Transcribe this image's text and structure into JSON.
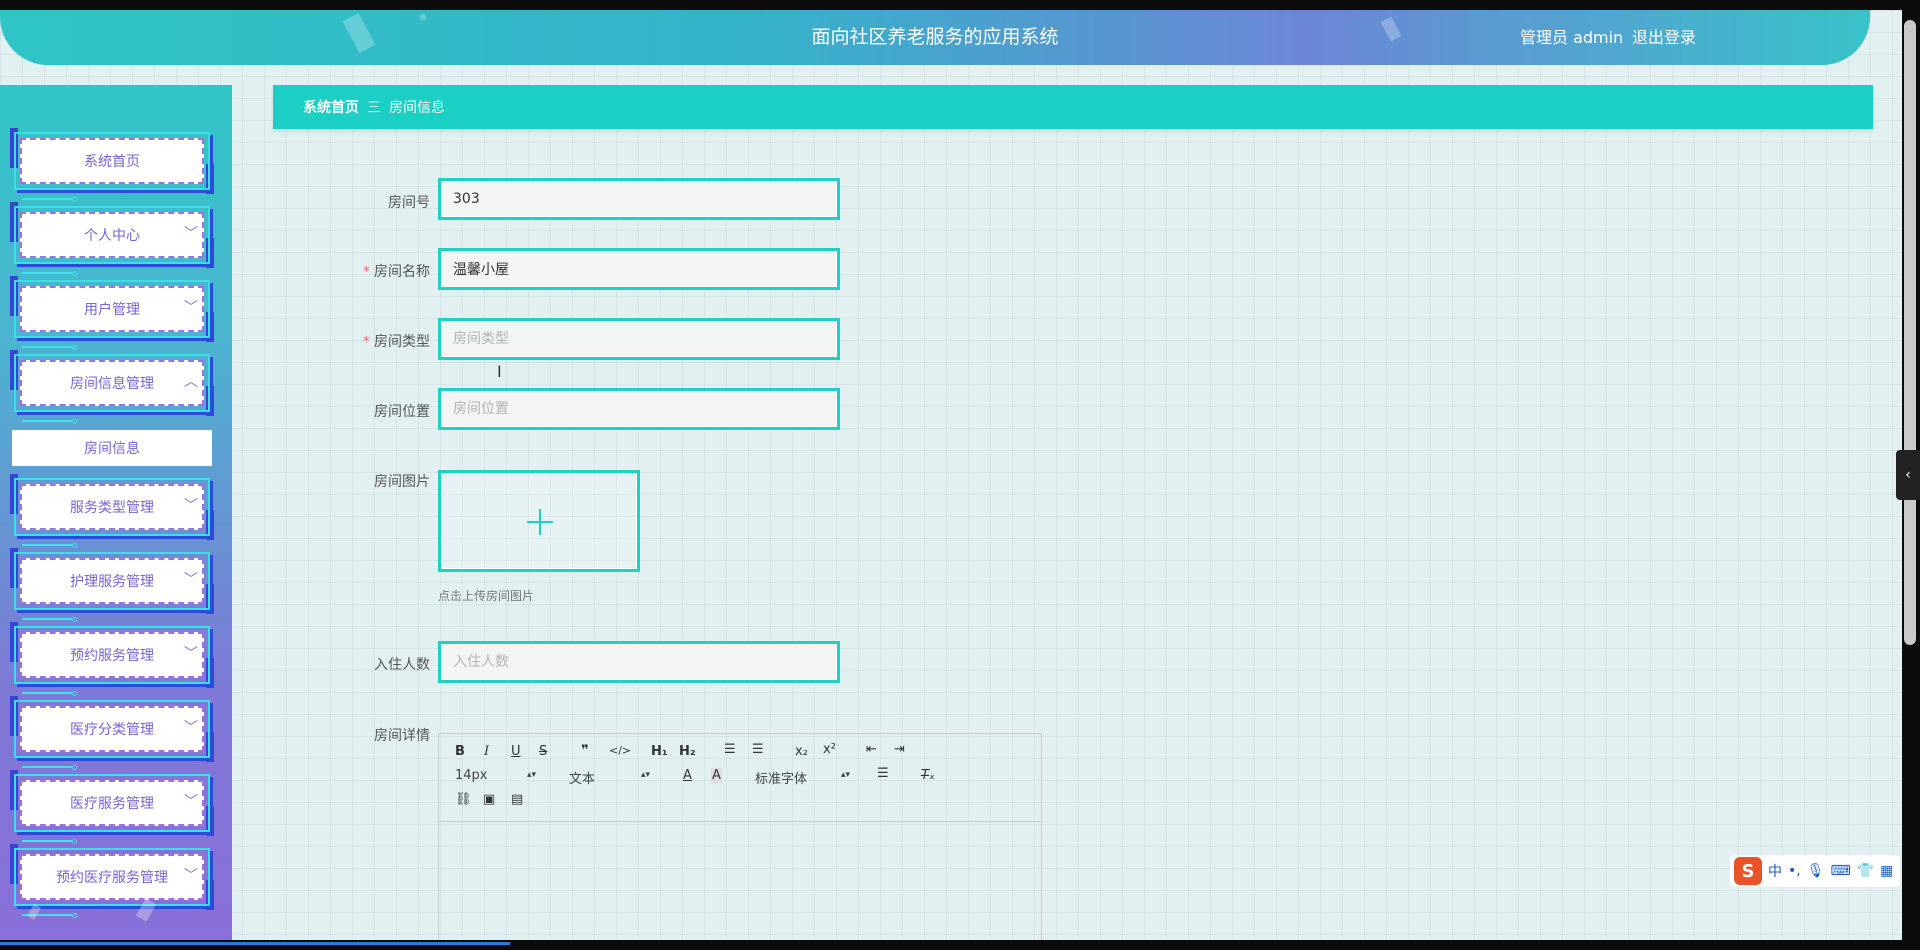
{
  "header": {
    "title": "面向社区养老服务的应用系统",
    "user": "管理员 admin",
    "logout": "退出登录"
  },
  "sidebar": {
    "items": [
      {
        "label": "系统首页",
        "chevron": ""
      },
      {
        "label": "个人中心",
        "chevron": "﹀"
      },
      {
        "label": "用户管理",
        "chevron": "﹀"
      },
      {
        "label": "房间信息管理",
        "chevron": "︿"
      },
      {
        "label": "服务类型管理",
        "chevron": "﹀"
      },
      {
        "label": "护理服务管理",
        "chevron": "﹀"
      },
      {
        "label": "预约服务管理",
        "chevron": "﹀"
      },
      {
        "label": "医疗分类管理",
        "chevron": "﹀"
      },
      {
        "label": "医疗服务管理",
        "chevron": "﹀"
      },
      {
        "label": "预约医疗服务管理",
        "chevron": "﹀"
      }
    ],
    "submenu": {
      "label": "房间信息"
    }
  },
  "breadcrumb": {
    "home": "系统首页",
    "separator": "三",
    "current": "房间信息"
  },
  "form": {
    "room_no": {
      "label": "房间号",
      "value": "303",
      "placeholder": "房间号"
    },
    "room_name": {
      "label": "房间名称",
      "value": "温馨小屋",
      "placeholder": "房间名称",
      "required": "*"
    },
    "room_type": {
      "label": "房间类型",
      "value": "",
      "placeholder": "房间类型",
      "required": "*"
    },
    "room_location": {
      "label": "房间位置",
      "value": "",
      "placeholder": "房间位置"
    },
    "room_image": {
      "label": "房间图片",
      "tip": "点击上传房间图片"
    },
    "occupants": {
      "label": "入住人数",
      "value": "",
      "placeholder": "入住人数"
    },
    "room_detail": {
      "label": "房间详情"
    }
  },
  "editor": {
    "font_size": "14px",
    "header_select": "文本",
    "font_family": "标准字体",
    "tools": [
      "bold",
      "italic",
      "underline",
      "strike",
      "blockquote",
      "code-block",
      "header-1",
      "header-2",
      "ordered-list",
      "bullet-list",
      "subscript",
      "superscript",
      "indent-decrease",
      "indent-increase",
      "font-color",
      "background-color",
      "align",
      "clean",
      "link",
      "image",
      "video"
    ]
  },
  "ime": {
    "label_zh": "中"
  },
  "colors": {
    "accent": "#1ccfc4",
    "menu_text": "#7a63d8",
    "required": "#f56c6c"
  }
}
